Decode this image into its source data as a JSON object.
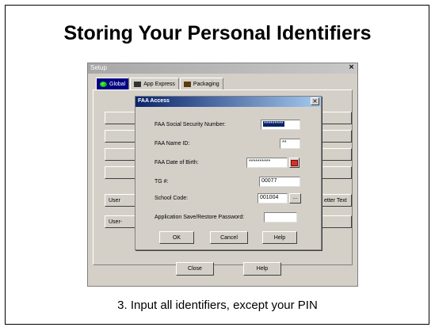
{
  "slide": {
    "title": "Storing Your Personal Identifiers",
    "caption": "3. Input all identifiers, except your PIN"
  },
  "setup_window": {
    "title": "Setup",
    "close_glyph": "×",
    "tabs": [
      {
        "label": "Global",
        "icon": "globe-icon"
      },
      {
        "label": "App Express",
        "icon": "app-express-icon"
      },
      {
        "label": "Packaging",
        "icon": "packaging-icon"
      }
    ],
    "background_buttons": [
      "User",
      "User-",
      "etter Text"
    ],
    "close_label": "Close",
    "help_label": "Help"
  },
  "faa_dialog": {
    "title": "FAA Access",
    "close_glyph": "×",
    "fields": {
      "ssn": {
        "label": "FAA Social Security Number:",
        "value": "*********"
      },
      "name_id": {
        "label": "FAA Name ID:",
        "value": "**"
      },
      "dob": {
        "label": "FAA Date of Birth:",
        "value": "**********"
      },
      "tg": {
        "label": "TG #:",
        "value": "00077"
      },
      "school_code": {
        "label": "School Code:",
        "value": "001004"
      },
      "password": {
        "label": "Application Save/Restore Password:",
        "value": ""
      }
    },
    "browse_label": "...",
    "ok_label": "OK",
    "cancel_label": "Cancel",
    "help_label": "Help"
  },
  "colors": {
    "dialog_face": "#d4d0c8",
    "active_title": "#0a246a",
    "active_tab": "#000080"
  }
}
